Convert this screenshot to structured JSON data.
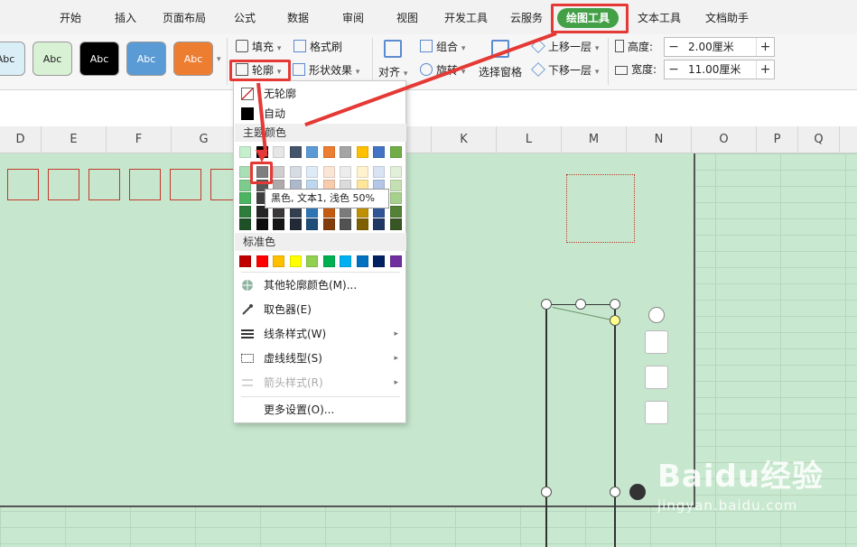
{
  "tabs": [
    {
      "label": "开始"
    },
    {
      "label": "插入"
    },
    {
      "label": "页面布局"
    },
    {
      "label": "公式"
    },
    {
      "label": "数据"
    },
    {
      "label": "审阅"
    },
    {
      "label": "视图"
    },
    {
      "label": "开发工具"
    },
    {
      "label": "云服务"
    },
    {
      "label": "绘图工具"
    },
    {
      "label": "文本工具"
    },
    {
      "label": "文档助手"
    }
  ],
  "shape_styles": [
    {
      "label": "Abc",
      "bg": "#d9eef7",
      "fg": "#222"
    },
    {
      "label": "Abc",
      "bg": "#d8f0d4",
      "fg": "#222"
    },
    {
      "label": "Abc",
      "bg": "#000000",
      "fg": "#ffffff"
    },
    {
      "label": "Abc",
      "bg": "#5b9bd5",
      "fg": "#ffffff"
    },
    {
      "label": "Abc",
      "bg": "#ed7d31",
      "fg": "#ffffff"
    }
  ],
  "ribbon": {
    "fill": "填充",
    "format_painter": "格式刷",
    "outline": "轮廓",
    "shape_effects": "形状效果",
    "align": "对齐",
    "group": "组合",
    "rotate": "旋转",
    "selection_pane": "选择窗格",
    "bring_forward": "上移一层",
    "send_backward": "下移一层",
    "height_label": "高度:",
    "height_value": "2.00厘米",
    "width_label": "宽度:",
    "width_value": "11.00厘米"
  },
  "columns": [
    "D",
    "E",
    "F",
    "G",
    "K",
    "L",
    "M",
    "N",
    "O",
    "P",
    "Q"
  ],
  "menu": {
    "no_outline": "无轮廓",
    "auto": "自动",
    "theme_colors": "主题颜色",
    "standard_colors": "标准色",
    "more_colors": "其他轮廓颜色(M)...",
    "eyedropper": "取色器(E)",
    "line_style": "线条样式(W)",
    "dash_style": "虚线线型(S)",
    "arrow_style": "箭头样式(R)",
    "more_settings": "更多设置(O)..."
  },
  "theme_top_row": [
    "#c6efce",
    "#000000",
    "#e7e6e6",
    "#44546a",
    "#5b9bd5",
    "#ed7d31",
    "#a5a5a5",
    "#ffc000",
    "#4472c4",
    "#70ad47"
  ],
  "theme_shades": [
    [
      "#a9dfb4",
      "#7f7f7f",
      "#d0cece",
      "#d6dce4",
      "#deebf6",
      "#fbe5d5",
      "#ededed",
      "#fff2cc",
      "#dae3f3",
      "#e2efd9"
    ],
    [
      "#7dcc8e",
      "#595959",
      "#aeaaaa",
      "#adb9ca",
      "#bdd7ee",
      "#f8cbad",
      "#dbdbdb",
      "#fee599",
      "#b4c7e7",
      "#c5e0b3"
    ],
    [
      "#4cb462",
      "#3f3f3f",
      "#757171",
      "#8496b0",
      "#9dc3e6",
      "#f4b183",
      "#c9c9c9",
      "#ffd966",
      "#8faadc",
      "#a8d08d"
    ],
    [
      "#2e7d3c",
      "#262626",
      "#3a3838",
      "#323f4f",
      "#2e75b5",
      "#c55a11",
      "#7b7b7b",
      "#bf9000",
      "#2f5597",
      "#538135"
    ],
    [
      "#1e5128",
      "#0d0d0d",
      "#171616",
      "#222a35",
      "#1f4e79",
      "#833c0b",
      "#525252",
      "#7f6000",
      "#203864",
      "#375623"
    ]
  ],
  "standard_colors": [
    "#c00000",
    "#ff0000",
    "#ffc000",
    "#ffff00",
    "#92d050",
    "#00b050",
    "#00b0f0",
    "#0070c0",
    "#002060",
    "#7030a0"
  ],
  "tooltip": "黑色, 文本1, 浅色 50%",
  "watermark": {
    "logo": "Baidu经验",
    "url": "jingyan.baidu.com"
  }
}
